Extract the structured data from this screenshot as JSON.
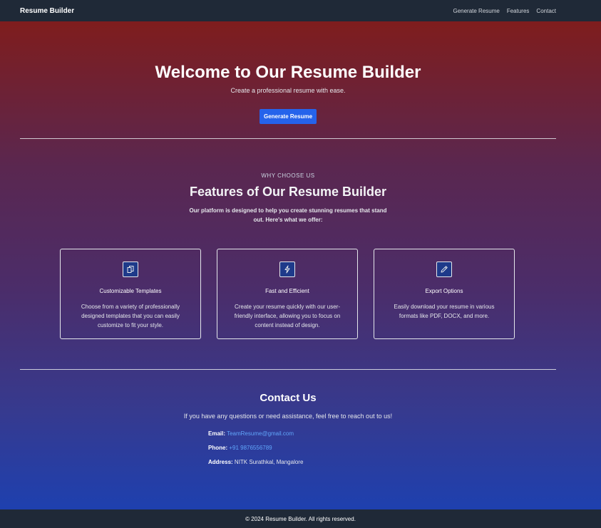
{
  "nav": {
    "brand": "Resume Builder",
    "links": [
      "Generate Resume",
      "Features",
      "Contact"
    ]
  },
  "hero": {
    "title": "Welcome to Our Resume Builder",
    "subtitle": "Create a professional resume with ease.",
    "button_label": "Generate Resume"
  },
  "features": {
    "eyebrow": "WHY CHOOSE US",
    "title": "Features of Our Resume Builder",
    "description": "Our platform is designed to help you create stunning resumes that stand out. Here's what we offer:",
    "cards": [
      {
        "icon": "templates-icon",
        "title": "Customizable Templates",
        "text": "Choose from a variety of professionally designed templates that you can easily customize to fit your style."
      },
      {
        "icon": "lightning-icon",
        "title": "Fast and Efficient",
        "text": "Create your resume quickly with our user-friendly interface, allowing you to focus on content instead of design."
      },
      {
        "icon": "pencil-icon",
        "title": "Export Options",
        "text": "Easily download your resume in various formats like PDF, DOCX, and more."
      }
    ]
  },
  "contact": {
    "title": "Contact Us",
    "subtitle": "If you have any questions or need assistance, feel free to reach out to us!",
    "email_label": "Email:",
    "email": "TeamResume@gmail.com",
    "phone_label": "Phone:",
    "phone": "+91 9876556789",
    "address_label": "Address:",
    "address": "NITK Surathkal, Mangalore"
  },
  "footer": {
    "text": "© 2024 Resume Builder. All rights reserved."
  },
  "colors": {
    "nav_bg": "#1f2937",
    "accent": "#2563eb",
    "link": "#60a5fa",
    "gradient_top": "#7f1d1d",
    "gradient_bottom": "#1e40af"
  }
}
